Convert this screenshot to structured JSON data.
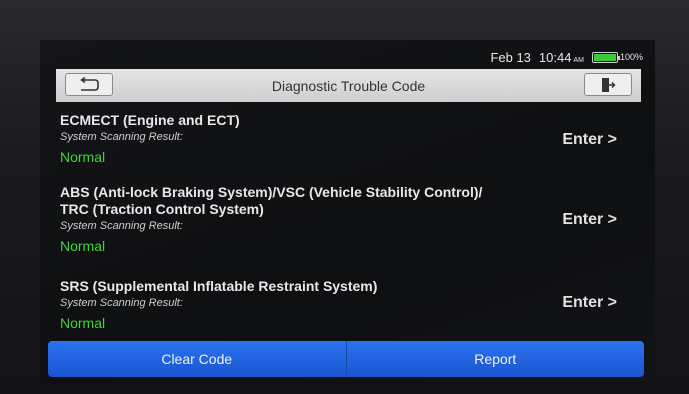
{
  "status_bar": {
    "date": "Feb 13",
    "time": "10:44",
    "ampm": "AM",
    "battery": "100%"
  },
  "header": {
    "title": "Diagnostic Trouble Code",
    "back_icon": "return-arrow-icon",
    "exit_icon": "exit-door-icon"
  },
  "systems": [
    {
      "name_lines": [
        "ECMECT (Engine and ECT)"
      ],
      "sub_label": "System Scanning Result:",
      "result": "Normal",
      "action": "Enter >"
    },
    {
      "name_lines": [
        "ABS (Anti-lock Braking System)/VSC (Vehicle Stability Control)/",
        "TRC (Traction Control System)"
      ],
      "sub_label": "System Scanning Result:",
      "result": "Normal",
      "action": "Enter >"
    },
    {
      "name_lines": [
        "SRS (Supplemental Inflatable Restraint System)"
      ],
      "sub_label": "System Scanning Result:",
      "result": "Normal",
      "action": "Enter >"
    }
  ],
  "footer": {
    "clear_label": "Clear Code",
    "report_label": "Report"
  },
  "colors": {
    "accent_blue": "#2b73f0",
    "normal_green": "#43d43a",
    "battery_green": "#3ec93a"
  }
}
